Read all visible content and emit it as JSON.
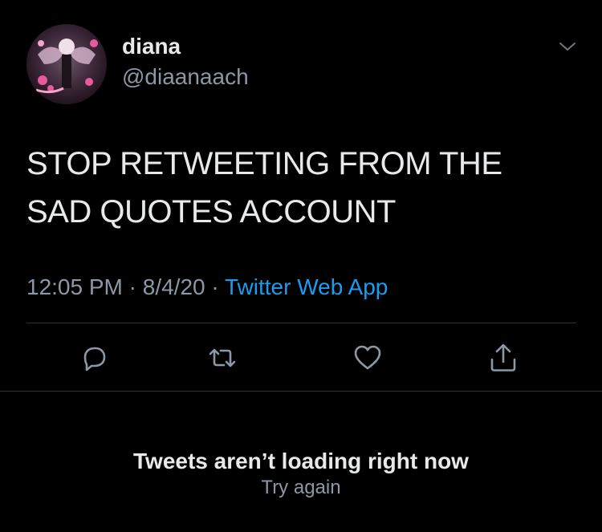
{
  "tweet": {
    "author": {
      "name": "diana",
      "handle": "@diaanaach",
      "avatar_icon": "profile-avatar-image"
    },
    "text": "STOP  RETWEETING FROM THE\nSAD QUOTES ACCOUNT",
    "time": "12:05 PM",
    "separator_1": " · ",
    "date": "8/4/20",
    "separator_2": " · ",
    "source": "Twitter Web App"
  },
  "actions": [
    {
      "icon": "reply-icon"
    },
    {
      "icon": "retweet-icon"
    },
    {
      "icon": "like-icon"
    },
    {
      "icon": "share-icon"
    }
  ],
  "feed_status": {
    "message": "Tweets aren’t loading right now",
    "retry_label": "Try again"
  },
  "colors": {
    "background": "#000000",
    "primary_text": "#e7e9ea",
    "secondary_text": "#8b98a5",
    "accent": "#1d9bf0",
    "divider": "#2f3336"
  }
}
